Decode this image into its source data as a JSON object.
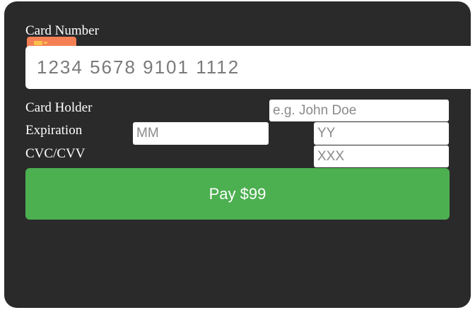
{
  "form": {
    "card_number_label": "Card Number",
    "card_number_placeholder": "1234 5678 9101 1112",
    "card_holder_label": "Card Holder",
    "card_holder_placeholder": "e.g. John Doe",
    "expiration_label": "Expiration",
    "month_placeholder": "MM",
    "year_placeholder": "YY",
    "cvc_label": "CVC/CVV",
    "cvc_placeholder": "XXX",
    "pay_label": "Pay $99"
  },
  "icons": {
    "card_chip": "card-chip-icon"
  },
  "colors": {
    "panel_background": "#2a2a2a",
    "pay_button": "#4caf50",
    "chip": "#f47f55"
  }
}
